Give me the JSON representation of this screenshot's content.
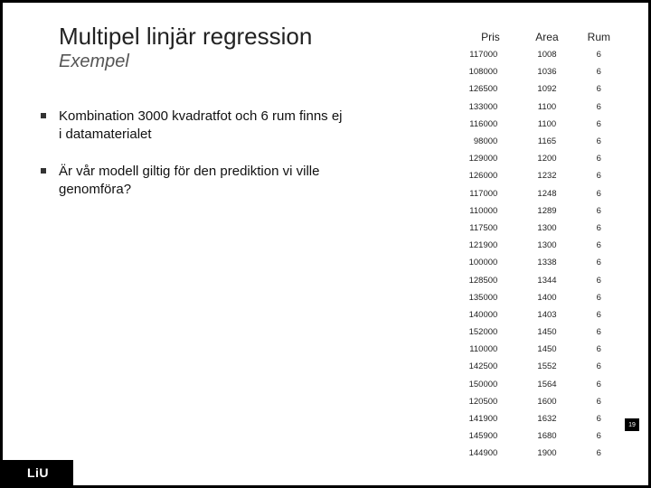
{
  "title": "Multipel linjär regression",
  "subtitle": "Exempel",
  "bullets": [
    "Kombination 3000 kvadratfot och 6 rum finns ej i datamaterialet",
    "Är vår modell giltig för den prediktion vi ville genomföra?"
  ],
  "footer": "LiU",
  "pagenum": "19",
  "chart_data": {
    "type": "table",
    "columns": [
      "Pris",
      "Area",
      "Rum"
    ],
    "rows": [
      [
        117000,
        1008,
        6
      ],
      [
        108000,
        1036,
        6
      ],
      [
        126500,
        1092,
        6
      ],
      [
        133000,
        1100,
        6
      ],
      [
        116000,
        1100,
        6
      ],
      [
        98000,
        1165,
        6
      ],
      [
        129000,
        1200,
        6
      ],
      [
        126000,
        1232,
        6
      ],
      [
        117000,
        1248,
        6
      ],
      [
        110000,
        1289,
        6
      ],
      [
        117500,
        1300,
        6
      ],
      [
        121900,
        1300,
        6
      ],
      [
        100000,
        1338,
        6
      ],
      [
        128500,
        1344,
        6
      ],
      [
        135000,
        1400,
        6
      ],
      [
        140000,
        1403,
        6
      ],
      [
        152000,
        1450,
        6
      ],
      [
        110000,
        1450,
        6
      ],
      [
        142500,
        1552,
        6
      ],
      [
        150000,
        1564,
        6
      ],
      [
        120500,
        1600,
        6
      ],
      [
        141900,
        1632,
        6
      ],
      [
        145900,
        1680,
        6
      ],
      [
        144900,
        1900,
        6
      ]
    ]
  }
}
